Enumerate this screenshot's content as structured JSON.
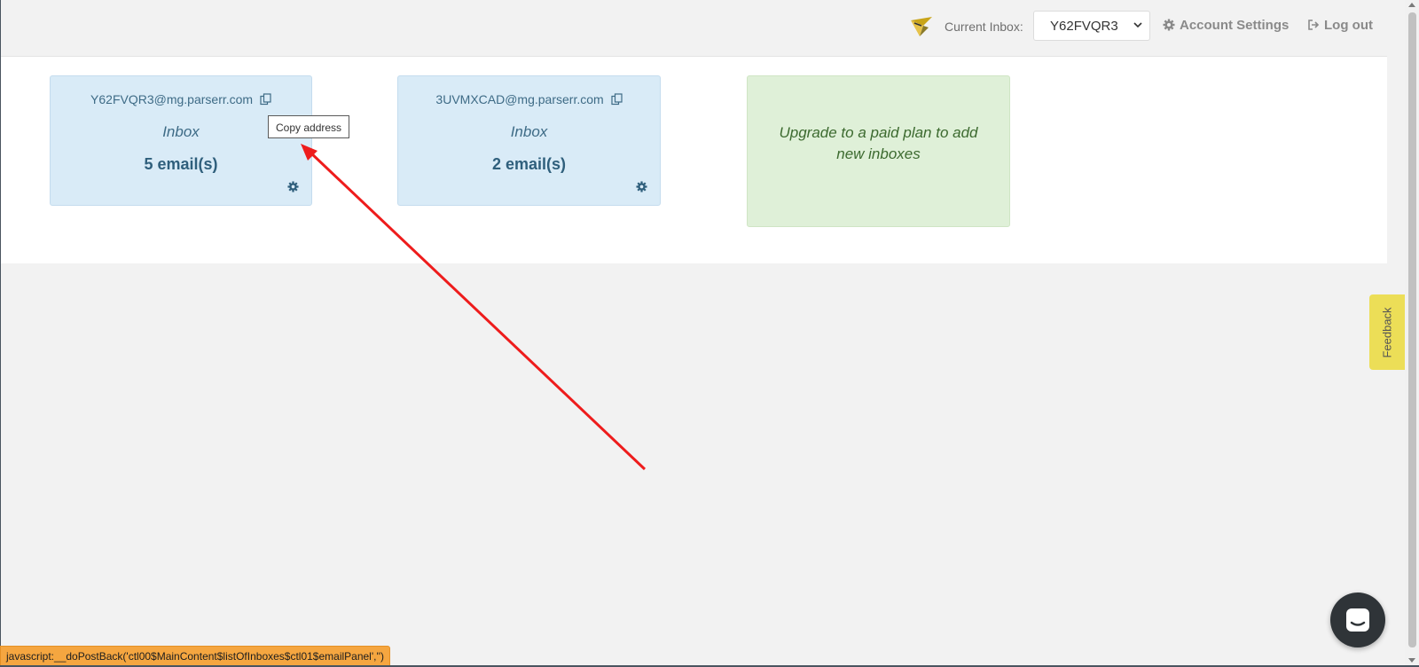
{
  "header": {
    "current_inbox_label": "Current Inbox:",
    "current_inbox_value": "Y62FVQR3",
    "account_settings_label": "Account Settings",
    "logout_label": "Log out"
  },
  "inboxes": [
    {
      "email": "Y62FVQR3@mg.parserr.com",
      "type": "Inbox",
      "count": "5 email(s)"
    },
    {
      "email": "3UVMXCAD@mg.parserr.com",
      "type": "Inbox",
      "count": "2 email(s)"
    }
  ],
  "upgrade": {
    "text": "Upgrade to a paid plan to add new inboxes"
  },
  "tooltip": {
    "text": "Copy address"
  },
  "feedback": {
    "label": "Feedback"
  },
  "status_bar": {
    "text": "javascript:__doPostBack('ctl00$MainContent$listOfInboxes$ctl01$emailPanel','')"
  },
  "colors": {
    "header_bg": "#f2f2f2",
    "card_bg": "#d9ebf7",
    "upgrade_bg": "#dff0d8",
    "feedback_bg": "#ecde57",
    "annotation_arrow": "#ee1c1c",
    "status_bar_bg": "#f5a640"
  },
  "icons": [
    "logo-bird-icon",
    "chevron-down-icon",
    "gear-icon",
    "logout-icon",
    "copy-icon",
    "chat-icon"
  ]
}
